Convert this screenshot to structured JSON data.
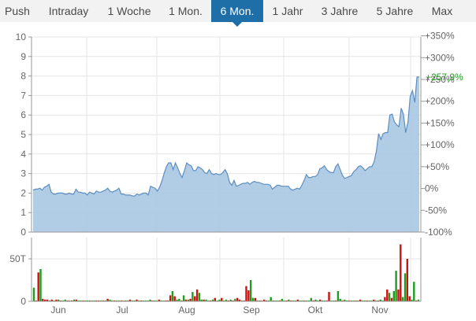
{
  "tabs": [
    {
      "label": "Push",
      "active": false
    },
    {
      "label": "Intraday",
      "active": false
    },
    {
      "label": "1 Woche",
      "active": false
    },
    {
      "label": "1 Mon.",
      "active": false
    },
    {
      "label": "6 Mon.",
      "active": true
    },
    {
      "label": "1 Jahr",
      "active": false
    },
    {
      "label": "3 Jahre",
      "active": false
    },
    {
      "label": "5 Jahre",
      "active": false
    },
    {
      "label": "Max",
      "active": false
    }
  ],
  "colors": {
    "area_fill": "#a9c6e2",
    "area_line": "#5d8ec0",
    "up": "#1e9e1e",
    "down": "#cc1111",
    "accent": "#1e6fa8",
    "last_value": "#229922"
  },
  "chart_data": [
    {
      "type": "area",
      "ylim": [
        0,
        10
      ],
      "yticks": [
        "0",
        "1",
        "2",
        "3",
        "4",
        "5",
        "6",
        "7",
        "8",
        "9",
        "10"
      ],
      "y2ticks": [
        "-100%",
        "-50%",
        "0%",
        "+50%",
        "+100%",
        "+150%",
        "+200%",
        "+250%",
        "+300%",
        "+350%"
      ],
      "last_value_label": "+257,9%",
      "xticks": [
        "Jun",
        "Jul",
        "Aug",
        "Sep",
        "Okt",
        "Nov"
      ],
      "values": [
        2.15,
        2.2,
        2.2,
        2.25,
        2.15,
        2.3,
        2.35,
        2.45,
        2.05,
        1.95,
        1.95,
        2.0,
        2.0,
        2.0,
        1.95,
        1.95,
        2.0,
        1.95,
        1.95,
        2.2,
        2.05,
        2.05,
        2.0,
        2.0,
        1.9,
        2.05,
        2.0,
        1.95,
        2.1,
        2.05,
        2.05,
        2.1,
        2.15,
        2.25,
        2.1,
        2.05,
        2.1,
        2.15,
        2.25,
        1.95,
        1.95,
        1.9,
        1.9,
        1.9,
        1.85,
        1.85,
        1.95,
        1.9,
        1.95,
        2.0,
        2.0,
        1.9,
        2.35,
        2.3,
        2.25,
        2.1,
        2.3,
        2.6,
        3.0,
        3.35,
        3.55,
        3.55,
        3.2,
        3.55,
        3.3,
        3.0,
        2.8,
        3.15,
        3.55,
        3.45,
        3.4,
        3.15,
        3.15,
        3.35,
        3.3,
        3.2,
        3.05,
        3.0,
        3.2,
        3.0,
        2.95,
        3.0,
        2.95,
        2.95,
        3.05,
        3.2,
        3.0,
        2.55,
        2.4,
        2.65,
        2.35,
        2.4,
        2.45,
        2.5,
        2.5,
        2.55,
        2.45,
        2.55,
        2.6,
        2.55,
        2.55,
        2.5,
        2.45,
        2.45,
        2.45,
        2.4,
        2.2,
        2.3,
        2.4,
        2.4,
        2.35,
        2.35,
        2.35,
        2.35,
        2.2,
        2.15,
        2.2,
        2.25,
        2.2,
        2.4,
        2.65,
        2.95,
        2.8,
        2.8,
        2.85,
        2.85,
        2.95,
        3.25,
        3.3,
        3.4,
        3.2,
        3.1,
        3.05,
        3.05,
        3.35,
        3.5,
        3.2,
        2.9,
        2.75,
        2.8,
        2.85,
        2.9,
        3.1,
        3.2,
        3.35,
        3.4,
        3.3,
        3.15,
        3.25,
        3.35,
        3.35,
        3.6,
        4.15,
        5.05,
        4.75,
        5.05,
        5.1,
        5.1,
        6.0,
        6.05,
        5.65,
        5.5,
        5.4,
        6.35,
        6.05,
        5.1,
        5.65,
        6.95,
        7.25,
        6.65,
        7.95,
        7.95
      ],
      "volume_yticks": [
        "0",
        "50T"
      ],
      "volume_ylim": [
        0,
        75
      ],
      "volumes": [
        {
          "v": 16,
          "up": true
        },
        {
          "v": 1,
          "up": false
        },
        {
          "v": 34,
          "up": false
        },
        {
          "v": 38,
          "up": true
        },
        {
          "v": 3,
          "up": false
        },
        {
          "v": 2,
          "up": false
        },
        {
          "v": 2,
          "up": false
        },
        {
          "v": 1,
          "up": true
        },
        {
          "v": 2,
          "up": false
        },
        {
          "v": 1,
          "up": true
        },
        {
          "v": 2,
          "up": false
        },
        {
          "v": 2,
          "up": true
        },
        {
          "v": 1,
          "up": false
        },
        {
          "v": 1,
          "up": true
        },
        {
          "v": 2,
          "up": true
        },
        {
          "v": 1,
          "up": false
        },
        {
          "v": 1,
          "up": true
        },
        {
          "v": 1,
          "up": false
        },
        {
          "v": 2,
          "up": true
        },
        {
          "v": 2,
          "up": false
        },
        {
          "v": 1,
          "up": true
        },
        {
          "v": 1,
          "up": true
        },
        {
          "v": 1,
          "up": false
        },
        {
          "v": 1,
          "up": true
        },
        {
          "v": 1,
          "up": true
        },
        {
          "v": 1,
          "up": false
        },
        {
          "v": 1,
          "up": true
        },
        {
          "v": 1,
          "up": true
        },
        {
          "v": 1,
          "up": false
        },
        {
          "v": 1,
          "up": false
        },
        {
          "v": 1,
          "up": true
        },
        {
          "v": 1,
          "up": false
        },
        {
          "v": 1,
          "up": true
        },
        {
          "v": 3,
          "up": false
        },
        {
          "v": 2,
          "up": true
        },
        {
          "v": 1,
          "up": true
        },
        {
          "v": 1,
          "up": false
        },
        {
          "v": 1,
          "up": true
        },
        {
          "v": 1,
          "up": true
        },
        {
          "v": 1,
          "up": false
        },
        {
          "v": 1,
          "up": true
        },
        {
          "v": 1,
          "up": false
        },
        {
          "v": 1,
          "up": true
        },
        {
          "v": 2,
          "up": false
        },
        {
          "v": 1,
          "up": true
        },
        {
          "v": 1,
          "up": true
        },
        {
          "v": 2,
          "up": false
        },
        {
          "v": 1,
          "up": true
        },
        {
          "v": 1,
          "up": false
        },
        {
          "v": 1,
          "up": true
        },
        {
          "v": 1,
          "up": true
        },
        {
          "v": 1,
          "up": true
        },
        {
          "v": 2,
          "up": true
        },
        {
          "v": 1,
          "up": false
        },
        {
          "v": 1,
          "up": true
        },
        {
          "v": 1,
          "up": true
        },
        {
          "v": 2,
          "up": false
        },
        {
          "v": 1,
          "up": true
        },
        {
          "v": 1,
          "up": true
        },
        {
          "v": 1,
          "up": false
        },
        {
          "v": 1,
          "up": false
        },
        {
          "v": 7,
          "up": false
        },
        {
          "v": 12,
          "up": true
        },
        {
          "v": 6,
          "up": false
        },
        {
          "v": 2,
          "up": true
        },
        {
          "v": 3,
          "up": true
        },
        {
          "v": 1,
          "up": false
        },
        {
          "v": 7,
          "up": true
        },
        {
          "v": 2,
          "up": false
        },
        {
          "v": 2,
          "up": true
        },
        {
          "v": 3,
          "up": false
        },
        {
          "v": 11,
          "up": true
        },
        {
          "v": 6,
          "up": false
        },
        {
          "v": 14,
          "up": false
        },
        {
          "v": 10,
          "up": true
        },
        {
          "v": 2,
          "up": true
        },
        {
          "v": 2,
          "up": false
        },
        {
          "v": 2,
          "up": true
        },
        {
          "v": 1,
          "up": true
        },
        {
          "v": 1,
          "up": false
        },
        {
          "v": 2,
          "up": true
        },
        {
          "v": 4,
          "up": false
        },
        {
          "v": 1,
          "up": true
        },
        {
          "v": 2,
          "up": true
        },
        {
          "v": 4,
          "up": false
        },
        {
          "v": 1,
          "up": true
        },
        {
          "v": 2,
          "up": true
        },
        {
          "v": 1,
          "up": false
        },
        {
          "v": 2,
          "up": true
        },
        {
          "v": 1,
          "up": false
        },
        {
          "v": 3,
          "up": true
        },
        {
          "v": 4,
          "up": false
        },
        {
          "v": 2,
          "up": false
        },
        {
          "v": 1,
          "up": true
        },
        {
          "v": 1,
          "up": false
        },
        {
          "v": 18,
          "up": false
        },
        {
          "v": 13,
          "up": false
        },
        {
          "v": 25,
          "up": true
        },
        {
          "v": 4,
          "up": true
        },
        {
          "v": 4,
          "up": false
        },
        {
          "v": 1,
          "up": true
        },
        {
          "v": 1,
          "up": false
        },
        {
          "v": 1,
          "up": true
        },
        {
          "v": 2,
          "up": false
        },
        {
          "v": 1,
          "up": false
        },
        {
          "v": 1,
          "up": true
        },
        {
          "v": 5,
          "up": true
        },
        {
          "v": 1,
          "up": false
        },
        {
          "v": 1,
          "up": true
        },
        {
          "v": 1,
          "up": true
        },
        {
          "v": 1,
          "up": false
        },
        {
          "v": 3,
          "up": true
        },
        {
          "v": 1,
          "up": true
        },
        {
          "v": 1,
          "up": false
        },
        {
          "v": 2,
          "up": true
        },
        {
          "v": 1,
          "up": false
        },
        {
          "v": 1,
          "up": true
        },
        {
          "v": 1,
          "up": true
        },
        {
          "v": 2,
          "up": false
        },
        {
          "v": 1,
          "up": true
        },
        {
          "v": 1,
          "up": true
        },
        {
          "v": 1,
          "up": false
        },
        {
          "v": 1,
          "up": true
        },
        {
          "v": 1,
          "up": true
        },
        {
          "v": 4,
          "up": true
        },
        {
          "v": 1,
          "up": false
        },
        {
          "v": 2,
          "up": true
        },
        {
          "v": 1,
          "up": true
        },
        {
          "v": 2,
          "up": false
        },
        {
          "v": 1,
          "up": true
        },
        {
          "v": 1,
          "up": true
        },
        {
          "v": 1,
          "up": false
        },
        {
          "v": 11,
          "up": false
        },
        {
          "v": 1,
          "up": true
        },
        {
          "v": 1,
          "up": true
        },
        {
          "v": 1,
          "up": false
        },
        {
          "v": 12,
          "up": true
        },
        {
          "v": 3,
          "up": true
        },
        {
          "v": 1,
          "up": false
        },
        {
          "v": 2,
          "up": true
        },
        {
          "v": 1,
          "up": true
        },
        {
          "v": 1,
          "up": false
        },
        {
          "v": 1,
          "up": true
        },
        {
          "v": 1,
          "up": true
        },
        {
          "v": 1,
          "up": false
        },
        {
          "v": 1,
          "up": true
        },
        {
          "v": 2,
          "up": false
        },
        {
          "v": 1,
          "up": true
        },
        {
          "v": 1,
          "up": true
        },
        {
          "v": 1,
          "up": false
        },
        {
          "v": 1,
          "up": true
        },
        {
          "v": 1,
          "up": true
        },
        {
          "v": 2,
          "up": false
        },
        {
          "v": 1,
          "up": true
        },
        {
          "v": 1,
          "up": false
        },
        {
          "v": 2,
          "up": true
        },
        {
          "v": 1,
          "up": true
        },
        {
          "v": 5,
          "up": false
        },
        {
          "v": 14,
          "up": false
        },
        {
          "v": 10,
          "up": true
        },
        {
          "v": 4,
          "up": false
        },
        {
          "v": 12,
          "up": true
        },
        {
          "v": 36,
          "up": true
        },
        {
          "v": 14,
          "up": false
        },
        {
          "v": 67,
          "up": false
        },
        {
          "v": 5,
          "up": true
        },
        {
          "v": 33,
          "up": true
        },
        {
          "v": 50,
          "up": false
        },
        {
          "v": 6,
          "up": false
        },
        {
          "v": 2,
          "up": true
        },
        {
          "v": 23,
          "up": true
        },
        {
          "v": 1,
          "up": false
        },
        {
          "v": 2,
          "up": true
        }
      ]
    }
  ]
}
